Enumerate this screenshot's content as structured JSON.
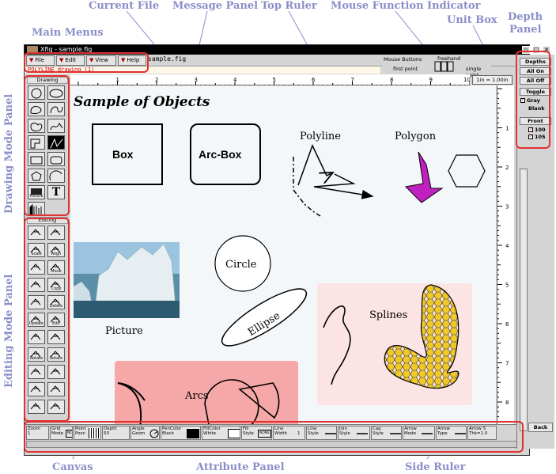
{
  "callouts": {
    "current_file": "Current File",
    "message_panel": "Message Panel",
    "top_ruler": "Top Ruler",
    "mouse_function": "Mouse Function Indicator",
    "unit_box": "Unit Box",
    "depth_panel_1": "Depth",
    "depth_panel_2": "Panel",
    "main_menus": "Main Menus",
    "drawing_mode_panel": "Drawing Mode Panel",
    "editing_mode_panel": "Editing Mode Panel",
    "canvas": "Canvas",
    "attribute_panel": "Attribute Panel",
    "side_ruler": "Side Ruler"
  },
  "window": {
    "title": "Xfig - sample.fig"
  },
  "menus": [
    "File",
    "Edit",
    "View",
    "Help"
  ],
  "current_file": "sample.fig",
  "message": "POLYLINE drawing    (1)",
  "mouse_fn": {
    "header": "Mouse Buttons",
    "mode": "freehand",
    "left": "first point",
    "right": "single point"
  },
  "unit_box": "1in = 1.00in",
  "top_ruler": {
    "labels": [
      "1",
      "2",
      "3",
      "4",
      "5",
      "6",
      "7",
      "8",
      "9",
      "10in"
    ]
  },
  "side_ruler": {
    "labels": [
      "1",
      "2",
      "3",
      "4",
      "5",
      "6",
      "7",
      "8"
    ]
  },
  "drawing_panel": {
    "header": "Drawing",
    "tools": [
      "circle",
      "ellipse",
      "closed-spline",
      "open-spline",
      "closed-interp-spline",
      "open-interp-spline",
      "polygon",
      "polyline",
      "box",
      "arc-box",
      "regular-polygon",
      "arc",
      "picture",
      "text",
      "library"
    ],
    "labels": {
      "picture": "Picture",
      "text": "T"
    }
  },
  "editing_panel": {
    "header": "Editing",
    "tools": [
      {
        "name": "compound",
        "label": ""
      },
      {
        "name": "break",
        "label": ""
      },
      {
        "name": "scale",
        "label": "Scale"
      },
      {
        "name": "align",
        "label": "Align"
      },
      {
        "name": "add-point",
        "label": ""
      },
      {
        "name": "move",
        "label": "Move"
      },
      {
        "name": "add-arrow",
        "label": ""
      },
      {
        "name": "copy",
        "label": "Copy"
      },
      {
        "name": "pen",
        "label": ""
      },
      {
        "name": "delete",
        "label": "Delete"
      },
      {
        "name": "update",
        "label": "Update"
      },
      {
        "name": "edit",
        "label": "Edit"
      },
      {
        "name": "flip-v",
        "label": ""
      },
      {
        "name": "flip-h",
        "label": ""
      },
      {
        "name": "rotate-cw",
        "label": "Rotate"
      },
      {
        "name": "rotate-ccw",
        "label": "Rotate"
      },
      {
        "name": "anchor",
        "label": ""
      },
      {
        "name": "tangent",
        "label": ""
      },
      {
        "name": "split",
        "label": ""
      },
      {
        "name": "join",
        "label": ""
      },
      {
        "name": "spline",
        "label": ""
      },
      {
        "name": "convert",
        "label": ""
      }
    ]
  },
  "canvas": {
    "title": "Sample of Objects",
    "box": "Box",
    "arcbox": "Arc-Box",
    "polyline": "Polyline",
    "polygon": "Polygon",
    "circle": "Circle",
    "picture": "Picture",
    "ellipse": "Ellipse",
    "splines": "Splines",
    "arcs": "Arcs"
  },
  "attributes": [
    {
      "l1": "Zoom",
      "l2": "1"
    },
    {
      "l1": "Grid",
      "l2": "Mode"
    },
    {
      "l1": "Point",
      "l2": "Posn"
    },
    {
      "l1": "Depth",
      "l2": "50"
    },
    {
      "l1": "Angle",
      "l2": "Geom"
    },
    {
      "l1": "PenColor",
      "l2": "Black"
    },
    {
      "l1": "FillColor",
      "l2": "White"
    },
    {
      "l1": "Fill",
      "l2": "Style"
    },
    {
      "l1": "Line",
      "l2": "Width"
    },
    {
      "l1": "Line",
      "l2": "Style"
    },
    {
      "l1": "Join",
      "l2": "Style"
    },
    {
      "l1": "Cap",
      "l2": "Style"
    },
    {
      "l1": "Arrow",
      "l2": "Mode"
    },
    {
      "l1": "Arrow",
      "l2": "Type"
    },
    {
      "l1": "Arrow S",
      "l2": "Thk=1.0"
    }
  ],
  "attr_values": {
    "grid_none": "NONE",
    "fill_none": "NONE",
    "line_width": "1"
  },
  "depth": {
    "header": "Depths",
    "all_on": "All On",
    "all_off": "All Off",
    "toggle": "Toggle",
    "gray": "Gray",
    "blank": "Blank",
    "front": "Front",
    "layers": [
      "100",
      "105"
    ],
    "back": "Back"
  },
  "colors": {
    "callout": "#8a8ec8",
    "highlight": "#e03030",
    "arcs_bg": "#f6a8a8",
    "splines_bg": "#fce4e4",
    "polygon_fill": "#c020c0",
    "spline_fill": "#f0c828"
  }
}
